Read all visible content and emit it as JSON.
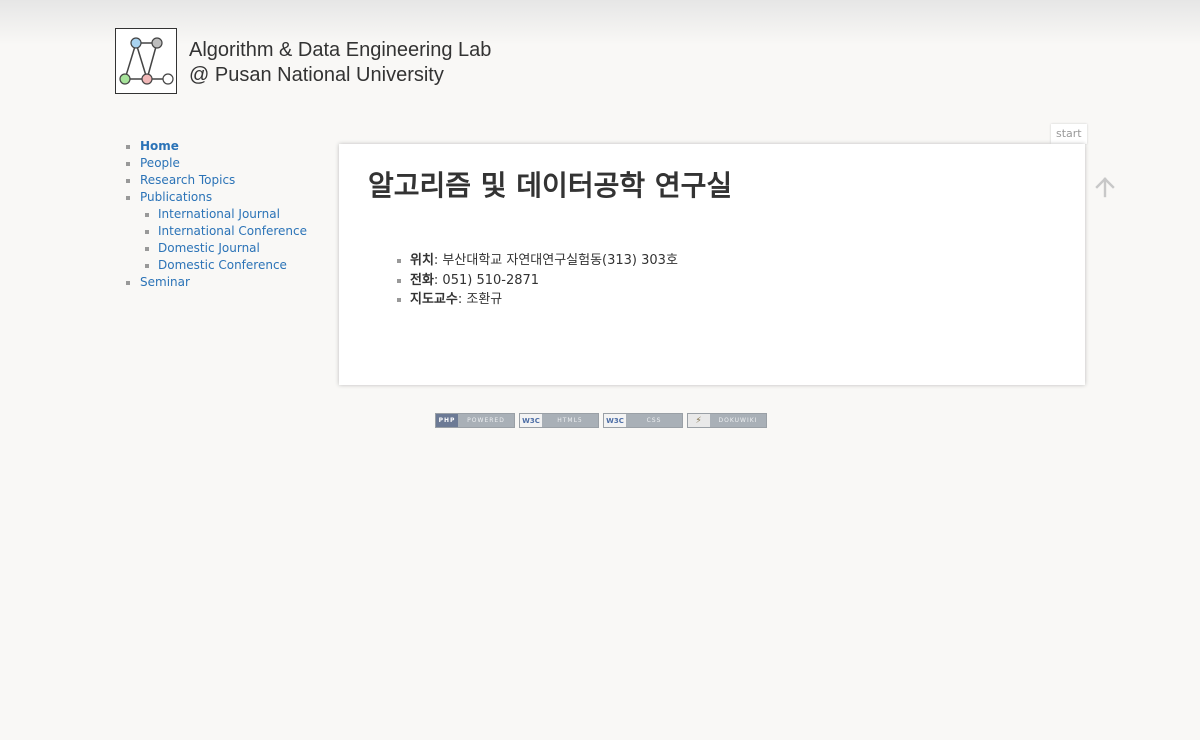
{
  "site": {
    "title_line1": "Algorithm & Data Engineering Lab",
    "title_line2": "@ Pusan National University"
  },
  "sidebar": {
    "items": [
      {
        "label": "Home",
        "current": true
      },
      {
        "label": "People"
      },
      {
        "label": "Research Topics"
      },
      {
        "label": "Publications"
      },
      {
        "label": "International Journal",
        "sub": true
      },
      {
        "label": "International Conference",
        "sub": true
      },
      {
        "label": "Domestic Journal",
        "sub": true
      },
      {
        "label": "Domestic Conference",
        "sub": true
      },
      {
        "label": "Seminar"
      }
    ]
  },
  "page": {
    "tab_label": "start",
    "heading": "알고리즘 및 데이터공학 연구실",
    "info": [
      {
        "key": "위치",
        "value": ": 부산대학교 자연대연구실험동(313) 303호"
      },
      {
        "key": "전화",
        "value": ": 051) 510-2871"
      },
      {
        "key": "지도교수",
        "value": ": 조환규"
      }
    ]
  },
  "footer": {
    "badges": [
      {
        "left": "PHP",
        "right": "POWERED"
      },
      {
        "left": "W3C",
        "right": "HTML5"
      },
      {
        "left": "W3C",
        "right": "CSS"
      },
      {
        "left": "⚡",
        "right": "DOKUWIKI"
      }
    ]
  },
  "colors": {
    "link": "#2b73b7",
    "background": "#f9f8f6",
    "text": "#333333"
  },
  "icons": {
    "logo": "graph-logo-icon",
    "back_to_top": "arrow-up-icon"
  }
}
